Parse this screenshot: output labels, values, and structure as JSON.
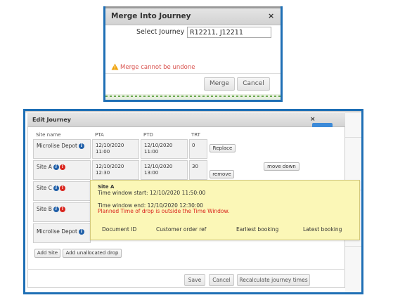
{
  "merge_dialog": {
    "title": "Merge Into Journey",
    "close_icon": "×",
    "select_journey_label": "Select Journey",
    "select_journey_value": "R12211, J12211",
    "warning_icon": "warning-triangle-icon",
    "warning_text": "Merge cannot be undone",
    "merge_button": "Merge",
    "cancel_button": "Cancel"
  },
  "edit_dialog": {
    "title": "Edit Journey",
    "close_icon": "×",
    "columns": [
      "Site name",
      "PTA",
      "PTD",
      "TRT"
    ],
    "rows": [
      {
        "site": "Microlise Depot",
        "pta": "12/10/2020 11:00",
        "ptd": "12/10/2020 11:00",
        "trt": "0",
        "action": "Replace"
      },
      {
        "site": "Site A",
        "pta": "12/10/2020 12:30",
        "ptd": "12/10/2020 13:00",
        "trt": "30",
        "action": "remove",
        "move": "move down"
      },
      {
        "site": "Site C"
      },
      {
        "site": "Site B"
      },
      {
        "site": "Microlise Depot"
      }
    ],
    "tooltip": {
      "site": "Site A",
      "start": "Time window start: 12/10/2020 11:50:00",
      "end": "Time window end: 12/10/2020 12:30:00",
      "warning": "Planned Time of drop is outside the Time Window.",
      "columns": [
        "Document ID",
        "Customer order ref",
        "Earliest booking",
        "Latest booking"
      ]
    },
    "add_site_button": "Add Site",
    "add_unallocated_button": "Add unallocated drop",
    "save_button": "Save",
    "cancel_button": "Cancel",
    "recalculate_button": "Recalculate journey times"
  },
  "colors": {
    "frame_blue": "#1e6fb5",
    "warning_red": "#d9534f",
    "info_blue": "#1f5fa8",
    "error_red": "#d9241d",
    "tooltip_yellow": "#fbf7b7"
  }
}
